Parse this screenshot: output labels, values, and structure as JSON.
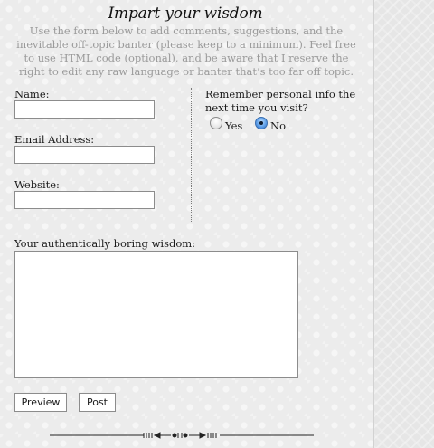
{
  "form": {
    "title": "Impart your wisdom",
    "intro": "Use the form below to add comments, suggestions, and the inevitable off-topic banter (please keep to a minimum). Feel free to use HTML code (optional), and be aware that I reserve the right to edit any raw language or banter that’s too far off topic.",
    "name_label": "Name:",
    "name_value": "",
    "email_label": "Email Address:",
    "email_value": "",
    "website_label": "Website:",
    "website_value": "",
    "remember_label": "Remember personal info the next time you visit?",
    "remember_options": [
      {
        "label": "Yes",
        "checked": false
      },
      {
        "label": "No",
        "checked": true
      }
    ],
    "comment_label": "Your authentically boring wisdom:",
    "comment_value": "",
    "preview_label": "Preview",
    "post_label": "Post"
  },
  "colors": {
    "background": "#ececec",
    "intro_text": "#9a9a9a",
    "radio_selected": "#5d9ee8"
  }
}
